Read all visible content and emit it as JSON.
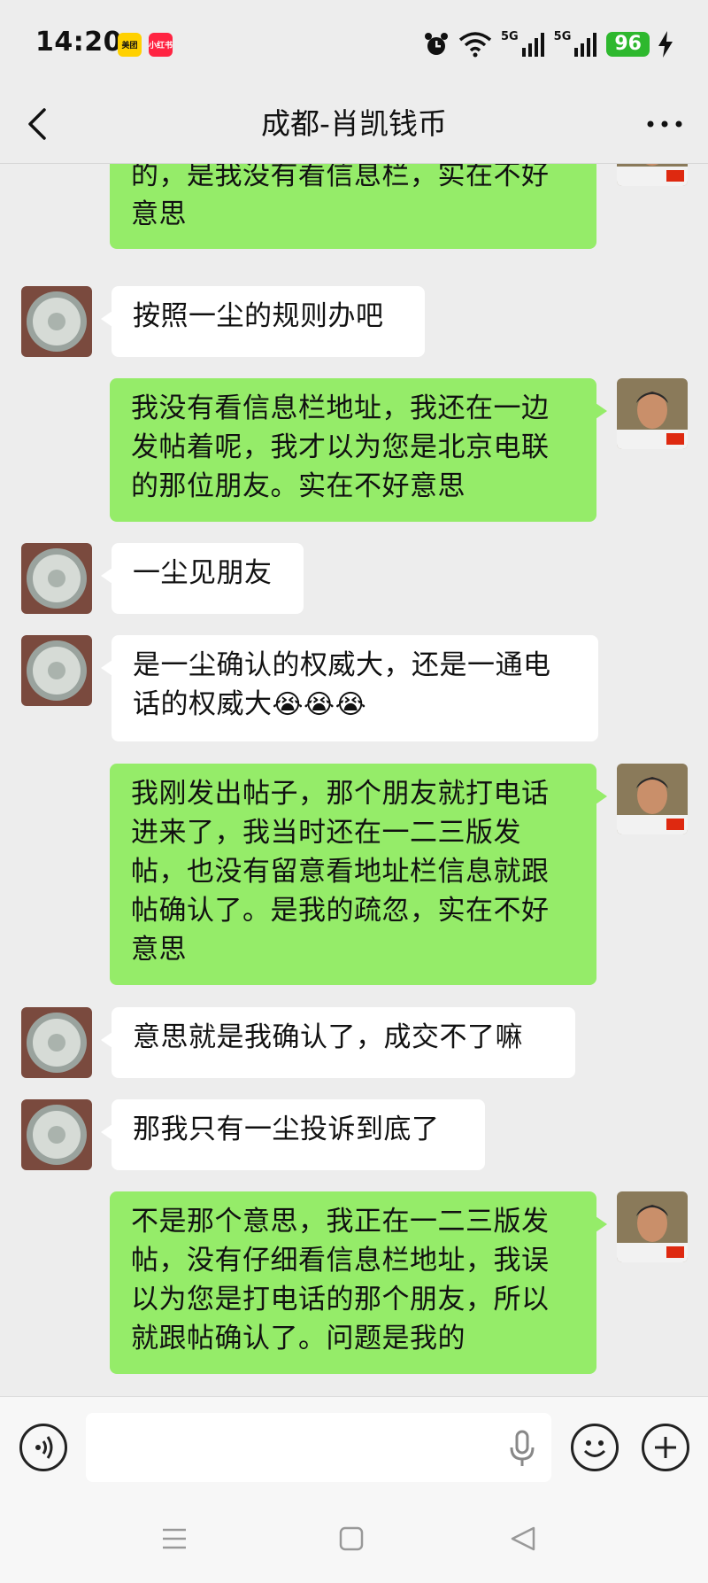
{
  "status_bar": {
    "time": "14:20",
    "apps": [
      "美团",
      "小红书"
    ],
    "battery": "96",
    "signal_labels": [
      "5G",
      "5G"
    ],
    "icons": [
      "alarm-icon",
      "wifi-icon",
      "signal-icon",
      "signal-icon",
      "battery-icon",
      "charging-icon"
    ]
  },
  "header": {
    "title": "成都-肖凯钱币",
    "back_icon": "chevron-left-icon",
    "more_icon": "more-dots-icon"
  },
  "messages": [
    {
      "from": "me",
      "text": "我只先注意是北京朋友与跟帖确认的，是我没有看信息栏，实在不好意思"
    },
    {
      "from": "other",
      "text": "按照一尘的规则办吧"
    },
    {
      "from": "me",
      "text": "我没有看信息栏地址，我还在一边发帖着呢，我才以为您是北京电联的那位朋友。实在不好意思"
    },
    {
      "from": "other",
      "text": "一尘见朋友"
    },
    {
      "from": "other",
      "text": "是一尘确认的权威大，还是一通电话的权威大",
      "emoji": "😭😭😭"
    },
    {
      "from": "me",
      "text": "我刚发出帖子，那个朋友就打电话进来了，我当时还在一二三版发帖，也没有留意看地址栏信息就跟帖确认了。是我的疏忽，实在不好意思"
    },
    {
      "from": "other",
      "text": "意思就是我确认了，成交不了嘛"
    },
    {
      "from": "other",
      "text": "那我只有一尘投诉到底了"
    },
    {
      "from": "me",
      "text": "不是那个意思，我正在一二三版发帖，没有仔细看信息栏地址，我误以为您是打电话的那个朋友，所以就跟帖确认了。问题是我的"
    }
  ],
  "input_bar": {
    "placeholder": "",
    "icons": [
      "voice-icon",
      "microphone-icon",
      "emoji-icon",
      "plus-icon"
    ]
  },
  "nav_bar": {
    "icons": [
      "menu-icon",
      "home-icon",
      "back-triangle-icon"
    ]
  },
  "colors": {
    "background": "#ededed",
    "my_bubble": "#95ec69",
    "other_bubble": "#ffffff",
    "battery": "#2eb82e"
  }
}
